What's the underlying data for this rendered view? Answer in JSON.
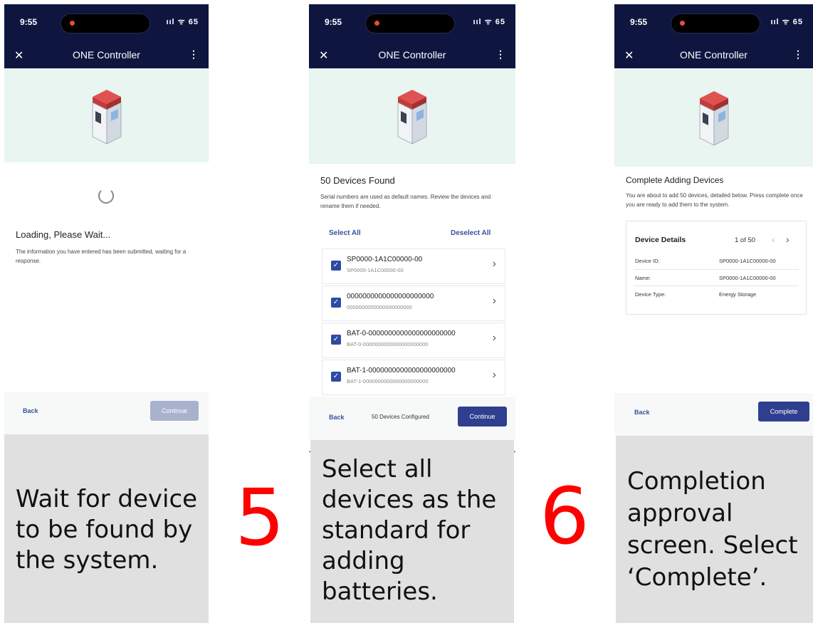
{
  "status_bar": {
    "time": "9:55",
    "signal": "ııl ᯤ 65"
  },
  "app": {
    "title": "ONE Controller",
    "close_glyph": "✕",
    "menu_glyph": "⋮"
  },
  "screen1": {
    "heading": "Loading, Please Wait...",
    "body": "The information you have entered has been submitted, waiting for a response.",
    "back": "Back",
    "continue": "Continue"
  },
  "screen2": {
    "heading": "50 Devices Found",
    "body": "Serial numbers are used as default names. Review the devices and rename them if needed.",
    "select_all": "Select All",
    "deselect_all": "Deselect All",
    "devices": [
      {
        "name": "SP0000-1A1C00000-00",
        "sub": "SP0000-1A1C00000-00"
      },
      {
        "name": "0000000000000000000000",
        "sub": "0000000000000000000000"
      },
      {
        "name": "BAT-0-0000000000000000000000",
        "sub": "BAT-0-0000000000000000000000"
      },
      {
        "name": "BAT-1-0000000000000000000000",
        "sub": "BAT-1-0000000000000000000000"
      }
    ],
    "back": "Back",
    "configured": "50 Devices Configured",
    "continue": "Continue"
  },
  "screen3": {
    "heading": "Complete Adding Devices",
    "body": "You are about to add 50 devices, detailed below. Press complete once you are ready to add them to the system.",
    "card_title": "Device Details",
    "pager": "1 of 50",
    "rows": [
      {
        "key": "Device ID:",
        "value": "SP0000-1A1C00000-00"
      },
      {
        "key": "Name:",
        "value": "SP0000-1A1C00000-00"
      },
      {
        "key": "Device Type:",
        "value": "Energy Storage"
      }
    ],
    "back": "Back",
    "complete": "Complete"
  },
  "captions": {
    "c1": "Wait for device to be found by the system.",
    "c2": "Select all devices as the standard for adding batteries.",
    "c3": "Completion approval screen. Select ‘Complete’."
  },
  "step_numbers": {
    "s5": "5",
    "s6": "6"
  },
  "colors": {
    "header": "#0e1640",
    "hero": "#e8f5f1",
    "accent": "#3a4fa0",
    "step_red": "#ff0000",
    "caption_bg": "#e0e0e0"
  }
}
